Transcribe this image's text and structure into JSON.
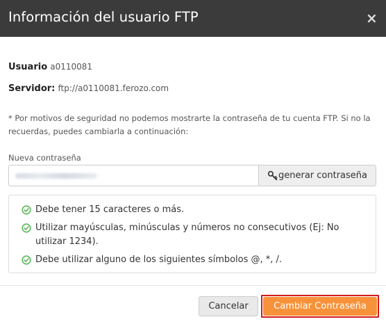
{
  "header": {
    "title": "Información del usuario FTP",
    "close_symbol": "×"
  },
  "info": {
    "user_label": "Usuario",
    "user_value": "a0110081",
    "server_label": "Servidor:",
    "server_value": "ftp://a0110081.ferozo.com"
  },
  "note": "* Por motivos de seguridad no podemos mostrarte la contraseña de tu cuenta FTP. Si no la recuerdas, puedes cambiarla a continuación:",
  "password": {
    "label": "Nueva contraseña",
    "generate_button": "generar contraseña"
  },
  "rules": [
    "Debe tener 15 caracteres o más.",
    "Utilizar mayúsculas, minúsculas y números no consecutivos (Ej: No utilizar 1234).",
    "Debe utilizar alguno de los siguientes símbolos @, *, /."
  ],
  "footer": {
    "cancel_label": "Cancelar",
    "submit_label": "Cambiar Contraseña"
  },
  "colors": {
    "header_bg": "#3b3b3b",
    "check_green": "#5cb85c",
    "submit_orange": "#f7923a",
    "highlight_red": "#d41a1a"
  },
  "icons": {
    "close": "close-icon",
    "key": "key-icon",
    "check": "check-circle-icon"
  }
}
